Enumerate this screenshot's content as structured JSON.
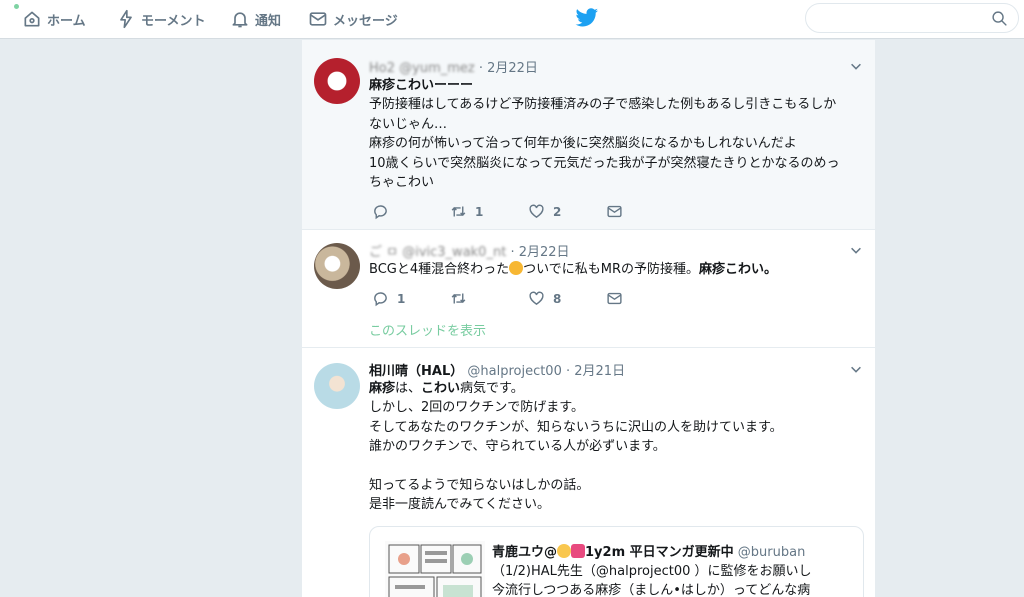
{
  "nav": {
    "home": "ホーム",
    "moments": "モーメント",
    "notifications": "通知",
    "messages": "メッセージ"
  },
  "search": {
    "placeholder": ""
  },
  "tweets": [
    {
      "handle": "Ho2 @yum_mez",
      "date": "· 2月22日",
      "lines": [
        "麻疹こわいーーー",
        "予防接種はしてあるけど予防接種済みの子で感染した例もあるし引きこもるしか",
        "ないじゃん…",
        "麻疹の何が怖いって治って何年か後に突然脳炎になるかもしれないんだよ",
        "10歳くらいで突然脳炎になって元気だった我が子が突然寝たきりとかなるのめっ",
        "ちゃこわい"
      ],
      "reply_count": "",
      "retweet_count": "1",
      "like_count": "2"
    },
    {
      "handle": "ご ㅁ @ivic3_wak0_nt",
      "date": "· 2月22日",
      "line_before": "BCGと4種混合終わった",
      "line_after": "ついでに私もMRの予防接種。",
      "line_bold": "麻疹こわい。",
      "reply_count": "1",
      "retweet_count": "",
      "like_count": "8",
      "thread_link": "このスレッドを表示"
    },
    {
      "name": "相川晴（HAL）",
      "handle": "@halproject00",
      "date": "· 2月21日",
      "line1_bold_a": "麻疹",
      "line1_mid": "は、",
      "line1_bold_b": "こわい",
      "line1_end": "病気です。",
      "lines": [
        "しかし、2回のワクチンで防げます。",
        "そしてあなたのワクチンが、知らないうちに沢山の人を助けています。",
        "誰かのワクチンで、守られている人が必ずいます。",
        "",
        "知ってるようで知らないはしかの話。",
        "是非一度読んでみてください。"
      ],
      "quote": {
        "name_a": "青鹿ユウ@",
        "name_b": "1y2m 平日マンガ更新中",
        "handle": "@buruban",
        "line1": "（1/2)HAL先生（@halproject00 ）に監修をお願いし",
        "line2": "今流行しつつある麻疹（ましん•はしか）ってどんな病"
      }
    }
  ],
  "colors": {
    "accent": "#1da1f2",
    "thread_link": "#78cca0",
    "muted": "#657786",
    "background": "#e6ecf0"
  },
  "icons": [
    "home-icon",
    "lightning-icon",
    "bell-icon",
    "mail-icon",
    "twitter-bird-icon",
    "search-icon",
    "reply-icon",
    "retweet-icon",
    "heart-icon",
    "dm-icon",
    "chevron-down-icon"
  ]
}
